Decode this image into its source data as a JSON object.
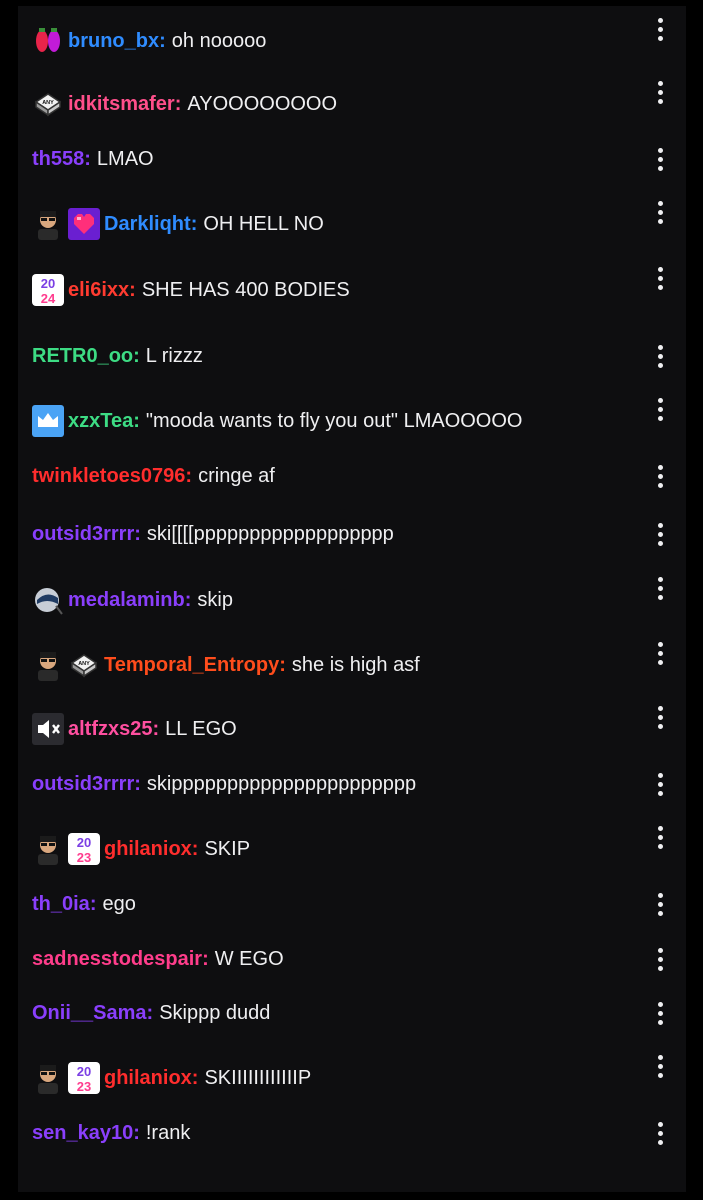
{
  "messages": [
    {
      "user": "bruno_bx",
      "color": "#2f8cff",
      "text": "oh nooooo",
      "badges": [
        "lights-icon"
      ]
    },
    {
      "user": "idkitsmafer",
      "color": "#ff4f8b",
      "text": "AYOOOOOOOO",
      "badges": [
        "any-key-icon"
      ]
    },
    {
      "user": "th558",
      "color": "#8a3ffc",
      "text": "LMAO",
      "badges": []
    },
    {
      "user": "Darkliqht",
      "color": "#2f8cff",
      "text": "OH HELL NO",
      "badges": [
        "avatar-face-icon",
        "pixel-heart-icon"
      ]
    },
    {
      "user": "eli6ixx",
      "color": "#ff3b30",
      "text": "SHE HAS 400 BODIES",
      "badges": [
        "year-2024-icon"
      ]
    },
    {
      "user": "RETR0_oo",
      "color": "#3ddc84",
      "text": "L rizzz",
      "badges": []
    },
    {
      "user": "xzxTea",
      "color": "#3ddc84",
      "text": "\"mooda wants to fly you out\" LMAOOOOO",
      "badges": [
        "crown-icon"
      ]
    },
    {
      "user": "twinkletoes0796",
      "color": "#ff2d2d",
      "text": "cringe af",
      "badges": []
    },
    {
      "user": "outsid3rrrr",
      "color": "#8a3ffc",
      "text": "ski[[[[pppppppppppppppppp",
      "badges": []
    },
    {
      "user": "medalaminb",
      "color": "#8a3ffc",
      "text": "skip",
      "badges": [
        "helmet-icon"
      ]
    },
    {
      "user": "Temporal_Entropy",
      "color": "#ff4d1c",
      "text": "she is high asf",
      "badges": [
        "avatar-face-icon",
        "any-key-icon"
      ]
    },
    {
      "user": "altfzxs25",
      "color": "#ff4fa0",
      "text": "LL EGO",
      "badges": [
        "muted-speaker-icon"
      ]
    },
    {
      "user": "outsid3rrrr",
      "color": "#8a3ffc",
      "text": "skipppppppppppppppppppppp",
      "badges": []
    },
    {
      "user": "ghilaniox",
      "color": "#ff2d2d",
      "text": "SKIP",
      "badges": [
        "avatar-face-icon",
        "year-2023-icon"
      ]
    },
    {
      "user": "th_0ia",
      "color": "#8a3ffc",
      "text": "ego",
      "badges": []
    },
    {
      "user": "sadnesstodespair",
      "color": "#ff3d8b",
      "text": "W EGO",
      "badges": []
    },
    {
      "user": "Onii__Sama",
      "color": "#8a3ffc",
      "text": "Skippp dudd",
      "badges": []
    },
    {
      "user": "ghilaniox",
      "color": "#ff2d2d",
      "text": "SKIIIIIIIIIIIIP",
      "badges": [
        "avatar-face-icon",
        "year-2023-icon"
      ]
    },
    {
      "user": "sen_kay10",
      "color": "#8a3ffc",
      "text": "!rank",
      "badges": []
    }
  ],
  "badge_labels": {
    "year-2024-icon": [
      "20",
      "24"
    ],
    "year-2023-icon": [
      "20",
      "23"
    ],
    "any-key-icon": "ANY"
  }
}
